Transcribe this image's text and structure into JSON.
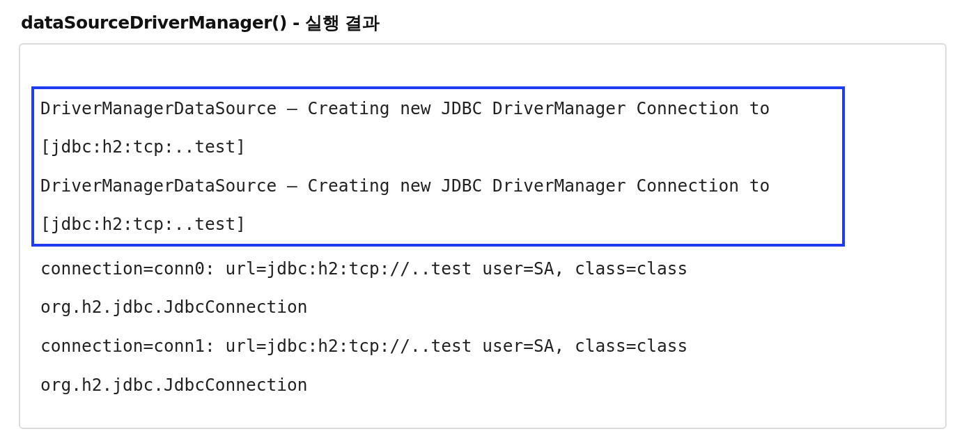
{
  "title": "dataSourceDriverManager() - 실행 결과",
  "log_blocks": [
    {
      "highlighted": true,
      "lines": [
        "DriverManagerDataSource – Creating new JDBC DriverManager Connection to",
        "[jdbc:h2:tcp:..test]",
        "DriverManagerDataSource – Creating new JDBC DriverManager Connection to",
        "[jdbc:h2:tcp:..test]"
      ]
    },
    {
      "highlighted": false,
      "lines": [
        "connection=conn0: url=jdbc:h2:tcp://..test user=SA, class=class",
        "org.h2.jdbc.JdbcConnection",
        "connection=conn1: url=jdbc:h2:tcp://..test user=SA, class=class",
        "org.h2.jdbc.JdbcConnection"
      ]
    }
  ]
}
